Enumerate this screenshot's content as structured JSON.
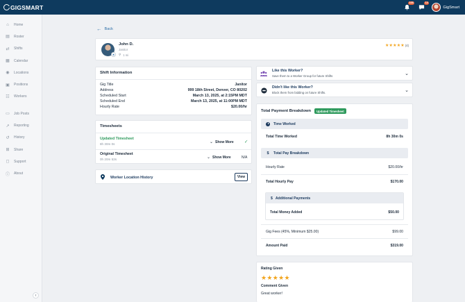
{
  "app": {
    "logo": "GIGSMART",
    "accent": "#0e3a5e",
    "success_color": "#2f9a5d",
    "star_color": "#f2a51e"
  },
  "topbar": {
    "notifications_icon": "bell-icon",
    "notifications_count": "166",
    "messages_icon": "chat-icon",
    "messages_count": "14",
    "user_name": "GigSmart"
  },
  "sidebar": {
    "items": [
      {
        "label": "Home",
        "icon": "home-icon"
      },
      {
        "label": "Roster",
        "icon": "clipboard-icon"
      },
      {
        "label": "Shifts",
        "icon": "shifts-icon"
      },
      {
        "label": "Calendar",
        "icon": "calendar-icon"
      },
      {
        "label": "Locations",
        "icon": "location-icon"
      },
      {
        "label": "Positions",
        "icon": "positions-icon"
      },
      {
        "label": "Workers",
        "icon": "workers-icon"
      },
      {
        "label": "Job Posts",
        "icon": "job-posts-icon"
      },
      {
        "label": "Reporting",
        "icon": "reporting-icon"
      },
      {
        "label": "History",
        "icon": "history-icon"
      },
      {
        "label": "Share",
        "icon": "share-icon"
      },
      {
        "label": "Support",
        "icon": "support-icon"
      },
      {
        "label": "About",
        "icon": "info-icon"
      }
    ]
  },
  "back_label": "Back",
  "worker": {
    "name": "John D.",
    "title": "Janitor",
    "distance": "1 mi",
    "rating": 5,
    "rating_count": "(4)"
  },
  "shift_info": {
    "title": "Shift Information",
    "rows": [
      {
        "label": "Gig Title",
        "value": "Janitor"
      },
      {
        "label": "Address",
        "value": "999 18th Street, Denver, CO 80202"
      },
      {
        "label": "Scheduled Start",
        "value": "March 13, 2025, at 2:15PM MDT"
      },
      {
        "label": "Scheduled End",
        "value": "March 13, 2025, at 11:00PM MDT"
      },
      {
        "label": "Hourly Rate",
        "value": "$20.00/hr"
      }
    ]
  },
  "timesheets": {
    "title": "Timesheets",
    "updated": {
      "name": "Updated Timesheet",
      "time": "8h 30m 0s",
      "action": "Show More"
    },
    "original": {
      "name": "Original Timesheet",
      "time": "0h 20m 53s",
      "action": "Show More",
      "status": "N/A"
    }
  },
  "location_history": {
    "label": "Worker Location History",
    "button": "View"
  },
  "like_worker": {
    "title": "Like this Worker?",
    "subtitle": "Save them to a Worker Group for future Shifts"
  },
  "dislike_worker": {
    "title": "Didn't like this Worker?",
    "subtitle": "Block them from bidding on future Shifts."
  },
  "payment": {
    "title": "Total Payment Breakdown",
    "badge": "Updated Timesheet",
    "time_worked_header": "Time Worked",
    "total_time_label": "Total Time Worked",
    "total_time_value": "8h 30m 0s",
    "pay_header": "Total Pay Breakdown",
    "hourly_rate_label": "Hourly Rate",
    "hourly_rate_value": "$20.00/hr",
    "total_hourly_label": "Total Hourly Pay",
    "total_hourly_value": "$170.00",
    "additional_header": "Additional Payments",
    "money_added_label": "Total Money Added",
    "money_added_value": "$50.00",
    "fees_label": "Gig Fees (45%, Minimum $25.00)",
    "fees_value": "$99.00",
    "amount_paid_label": "Amount Paid",
    "amount_paid_value": "$319.00"
  },
  "rating": {
    "label": "Rating Given",
    "stars": 5,
    "comment_label": "Comment Given",
    "comment": "Great worker!"
  }
}
